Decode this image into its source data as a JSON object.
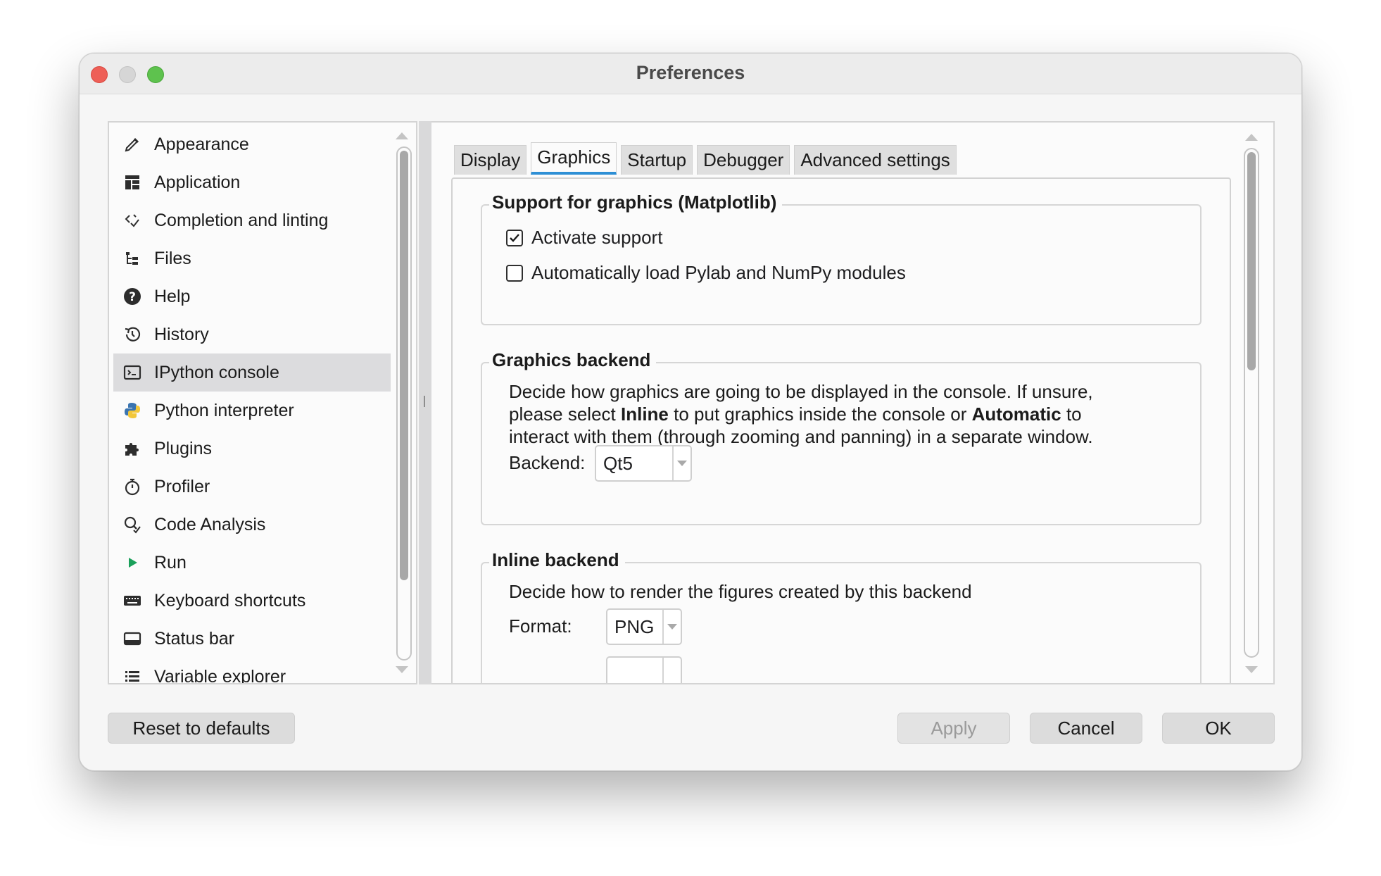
{
  "window": {
    "title": "Preferences"
  },
  "sidebar": {
    "items": [
      {
        "label": "Appearance",
        "icon": "paintbrush-icon"
      },
      {
        "label": "Application",
        "icon": "layout-icon"
      },
      {
        "label": "Completion and linting",
        "icon": "code-check-icon"
      },
      {
        "label": "Files",
        "icon": "file-tree-icon"
      },
      {
        "label": "Help",
        "icon": "help-icon"
      },
      {
        "label": "History",
        "icon": "history-icon"
      },
      {
        "label": "IPython console",
        "icon": "console-icon",
        "selected": true
      },
      {
        "label": "Python interpreter",
        "icon": "python-icon"
      },
      {
        "label": "Plugins",
        "icon": "puzzle-icon"
      },
      {
        "label": "Profiler",
        "icon": "stopwatch-icon"
      },
      {
        "label": "Code Analysis",
        "icon": "search-check-icon"
      },
      {
        "label": "Run",
        "icon": "play-icon"
      },
      {
        "label": "Keyboard shortcuts",
        "icon": "keyboard-icon"
      },
      {
        "label": "Status bar",
        "icon": "status-bar-icon"
      },
      {
        "label": "Variable explorer",
        "icon": "list-icon"
      }
    ]
  },
  "tabs": [
    "Display",
    "Graphics",
    "Startup",
    "Debugger",
    "Advanced settings"
  ],
  "active_tab": "Graphics",
  "graphics_support": {
    "title": "Support for graphics (Matplotlib)",
    "activate_label": "Activate support",
    "activate_checked": true,
    "pylab_label": "Automatically load Pylab and NumPy modules",
    "pylab_checked": false
  },
  "graphics_backend": {
    "title": "Graphics backend",
    "desc_1": "Decide how graphics are going to be displayed in the console. If unsure,",
    "desc_2a": "please select ",
    "desc_2b": "Inline",
    "desc_2c": " to put graphics inside the console or ",
    "desc_2d": "Automatic",
    "desc_2e": " to",
    "desc_3": "interact with them (through zooming and panning) in a separate window.",
    "backend_label": "Backend:",
    "backend_value": "Qt5"
  },
  "inline_backend": {
    "title": "Inline backend",
    "desc": "Decide how to render the figures created by this backend",
    "format_label": "Format:",
    "format_value": "PNG"
  },
  "buttons": {
    "reset": "Reset to defaults",
    "apply": "Apply",
    "cancel": "Cancel",
    "ok": "OK"
  },
  "colors": {
    "accent": "#2d8fd5",
    "selected_row": "#dcdcde"
  }
}
